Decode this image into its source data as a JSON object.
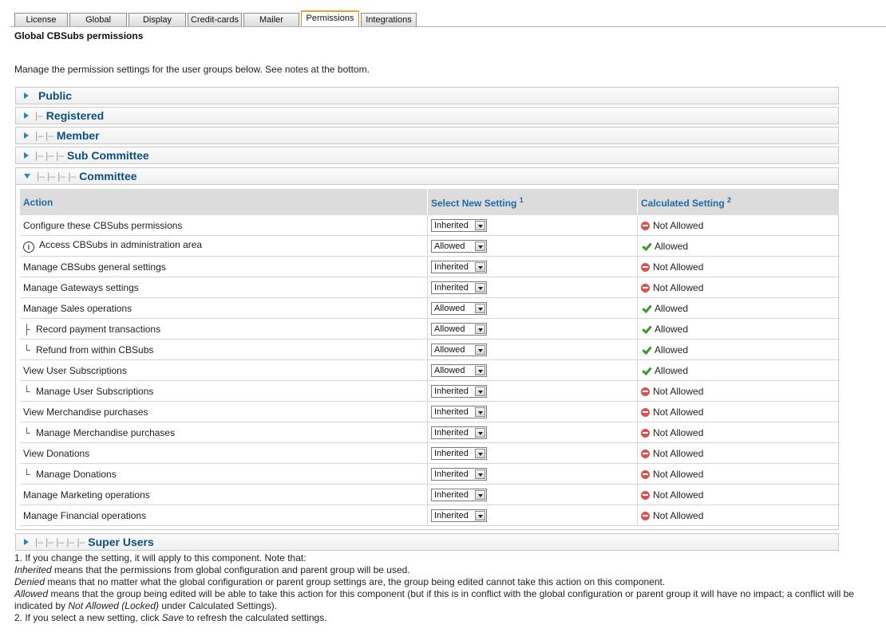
{
  "tabs": [
    {
      "label": "License",
      "w": 67
    },
    {
      "label": "Global",
      "w": 72
    },
    {
      "label": "Display",
      "w": 72
    },
    {
      "label": "Credit-cards",
      "w": 68
    },
    {
      "label": "Mailer",
      "w": 70
    },
    {
      "label": "Permissions",
      "w": 73,
      "active": true
    },
    {
      "label": "Integrations",
      "w": 70
    }
  ],
  "page_title": "Global CBSubs permissions",
  "intro": "Manage the permission settings for the user groups below. See notes at the bottom.",
  "groups_above": [
    {
      "prefix": "",
      "name": "Public"
    },
    {
      "prefix": "|–",
      "name": "Registered"
    },
    {
      "prefix": "|– |–",
      "name": "Member"
    },
    {
      "prefix": "|– |– |–",
      "name": "Sub Committee"
    }
  ],
  "expanded_group": {
    "prefix": "|– |– |– |–",
    "name": "Committee"
  },
  "groups_below": [
    {
      "prefix": "|– |– |– |– |–",
      "name": "Super Users"
    }
  ],
  "table": {
    "headers": {
      "action": "Action",
      "select": "Select New Setting",
      "select_note": "1",
      "calc": "Calculated Setting",
      "calc_note": "2"
    },
    "rows": [
      {
        "tree": "",
        "info": false,
        "action": "Configure these CBSubs permissions",
        "setting": "Inherited",
        "calc": "Not Allowed",
        "status": "na"
      },
      {
        "tree": "",
        "info": true,
        "action": "Access CBSubs in administration area",
        "setting": "Allowed",
        "calc": "Allowed",
        "status": "ok"
      },
      {
        "tree": "",
        "info": false,
        "action": "Manage CBSubs general settings",
        "setting": "Inherited",
        "calc": "Not Allowed",
        "status": "na"
      },
      {
        "tree": "",
        "info": false,
        "action": "Manage Gateways settings",
        "setting": "Inherited",
        "calc": "Not Allowed",
        "status": "na"
      },
      {
        "tree": "",
        "info": false,
        "action": "Manage Sales operations",
        "setting": "Allowed",
        "calc": "Allowed",
        "status": "ok"
      },
      {
        "tree": "├",
        "info": false,
        "action": "Record payment transactions",
        "setting": "Allowed",
        "calc": "Allowed",
        "status": "ok"
      },
      {
        "tree": "└",
        "info": false,
        "action": "Refund from within CBSubs",
        "setting": "Allowed",
        "calc": "Allowed",
        "status": "ok"
      },
      {
        "tree": "",
        "info": false,
        "action": "View User Subscriptions",
        "setting": "Allowed",
        "calc": "Allowed",
        "status": "ok"
      },
      {
        "tree": "└",
        "info": false,
        "action": "Manage User Subscriptions",
        "setting": "Inherited",
        "calc": "Not Allowed",
        "status": "na"
      },
      {
        "tree": "",
        "info": false,
        "action": "View Merchandise purchases",
        "setting": "Inherited",
        "calc": "Not Allowed",
        "status": "na"
      },
      {
        "tree": "└",
        "info": false,
        "action": "Manage Merchandise purchases",
        "setting": "Inherited",
        "calc": "Not Allowed",
        "status": "na"
      },
      {
        "tree": "",
        "info": false,
        "action": "View Donations",
        "setting": "Inherited",
        "calc": "Not Allowed",
        "status": "na"
      },
      {
        "tree": "└",
        "info": false,
        "action": "Manage Donations",
        "setting": "Inherited",
        "calc": "Not Allowed",
        "status": "na"
      },
      {
        "tree": "",
        "info": false,
        "action": "Manage Marketing operations",
        "setting": "Inherited",
        "calc": "Not Allowed",
        "status": "na"
      },
      {
        "tree": "",
        "info": false,
        "action": "Manage Financial operations",
        "setting": "Inherited",
        "calc": "Not Allowed",
        "status": "na"
      }
    ]
  },
  "notes": {
    "line1": "1. If you change the setting, it will apply to this component. Note that:",
    "inherited_term": "Inherited",
    "inherited_text": " means that the permissions from global configuration and parent group will be used.",
    "denied_term": "Denied",
    "denied_text": " means that no matter what the global configuration or parent group settings are, the group being edited cannot take this action on this component.",
    "allowed_term": "Allowed",
    "allowed_text_a": " means that the group being edited will be able to take this action for this component (but if this is in conflict with the global configuration or parent group it will have no impact; a conflict will be indicated by ",
    "locked_term": "Not Allowed (Locked)",
    "allowed_text_b": " under Calculated Settings).",
    "line2_a": "2. If you select a new setting, click ",
    "save_term": "Save",
    "line2_b": " to refresh the calculated settings."
  }
}
